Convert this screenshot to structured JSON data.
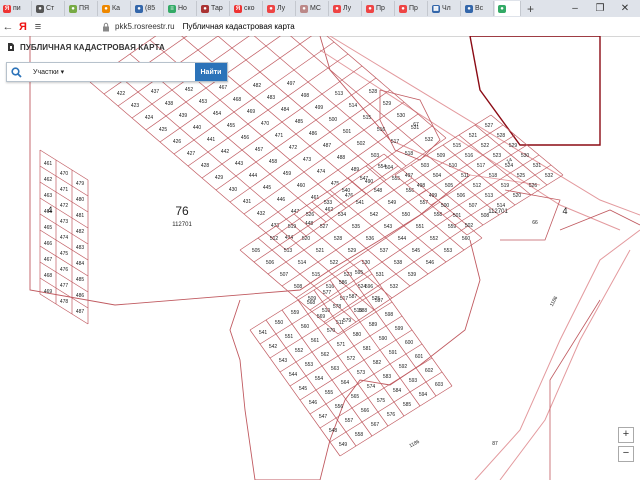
{
  "browser": {
    "tabs": [
      {
        "label": "пи",
        "fav": "Я",
        "color": "#e33"
      },
      {
        "label": "Ст",
        "fav": "●",
        "color": "#555"
      },
      {
        "label": "ПЯ",
        "fav": "●",
        "color": "#7a4"
      },
      {
        "label": "Ка",
        "fav": "●",
        "color": "#e80"
      },
      {
        "label": "(85",
        "fav": "●",
        "color": "#36a"
      },
      {
        "label": "Но",
        "fav": "≡",
        "color": "#3a6"
      },
      {
        "label": "Тар",
        "fav": "●",
        "color": "#a33"
      },
      {
        "label": "ско",
        "fav": "Я",
        "color": "#e33"
      },
      {
        "label": "Лу",
        "fav": "●",
        "color": "#e44"
      },
      {
        "label": "МС",
        "fav": "●",
        "color": "#b88"
      },
      {
        "label": "Лу",
        "fav": "●",
        "color": "#e44"
      },
      {
        "label": "Пр",
        "fav": "●",
        "color": "#e44"
      },
      {
        "label": "Пр",
        "fav": "●",
        "color": "#e44"
      },
      {
        "label": "Чл",
        "fav": "▦",
        "color": "#36a"
      },
      {
        "label": "Вс",
        "fav": "●",
        "color": "#36a"
      },
      {
        "label": "",
        "fav": "●",
        "color": "#3a6"
      }
    ],
    "url": "pkk5.rosreestr.ru",
    "page_title": "Публичная кадастровая карта"
  },
  "app": {
    "title": "ПУБЛИЧНАЯ КАДАСТРОВАЯ КАРТА",
    "search": {
      "category": "Участки",
      "placeholder": "",
      "button": "Найти"
    }
  },
  "map": {
    "colors": {
      "parcel": "#c05a60",
      "boundary": "#e39a9e",
      "zone": "#8b0a14",
      "label": "#222"
    },
    "zoom": {
      "in": "+",
      "out": "−"
    }
  }
}
